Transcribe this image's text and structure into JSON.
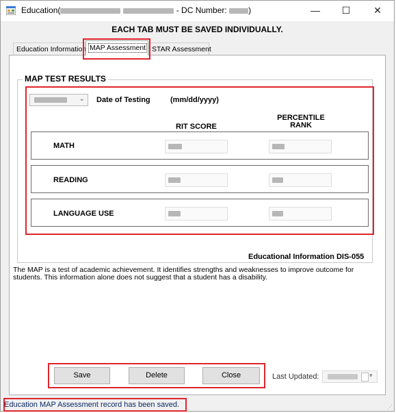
{
  "window": {
    "title_prefix": "Education(",
    "title_dc_label": " - DC Number: ",
    "title_suffix": ")",
    "controls": {
      "minimize": "—",
      "maximize": "☐",
      "close": "✕"
    }
  },
  "notice": "EACH TAB MUST BE SAVED INDIVIDUALLY.",
  "tabs": [
    {
      "label": "Education Information"
    },
    {
      "label": "MAP Assessment"
    },
    {
      "label": "STAR Assessment"
    }
  ],
  "map": {
    "group_title": "MAP TEST RESULTS",
    "date_label": "Date of Testing",
    "date_format": "(mm/dd/yyyy)",
    "col_rit": "RIT SCORE",
    "col_percentile": "PERCENTILE\nRANK",
    "rows": [
      {
        "label": "MATH"
      },
      {
        "label": "READING"
      },
      {
        "label": "LANGUAGE USE"
      }
    ]
  },
  "form_id": "Educational Information DIS-055",
  "description": "The MAP is a test of academic achievement. It identifies strengths and weaknesses to improve outcome for students. This information alone does not suggest that a student has a disability.",
  "buttons": {
    "save": "Save",
    "delete": "Delete",
    "close": "Close"
  },
  "last_updated_label": "Last Updated:",
  "status": "Education MAP Assessment record has been saved.",
  "colors": {
    "highlight": "#e0232c"
  }
}
